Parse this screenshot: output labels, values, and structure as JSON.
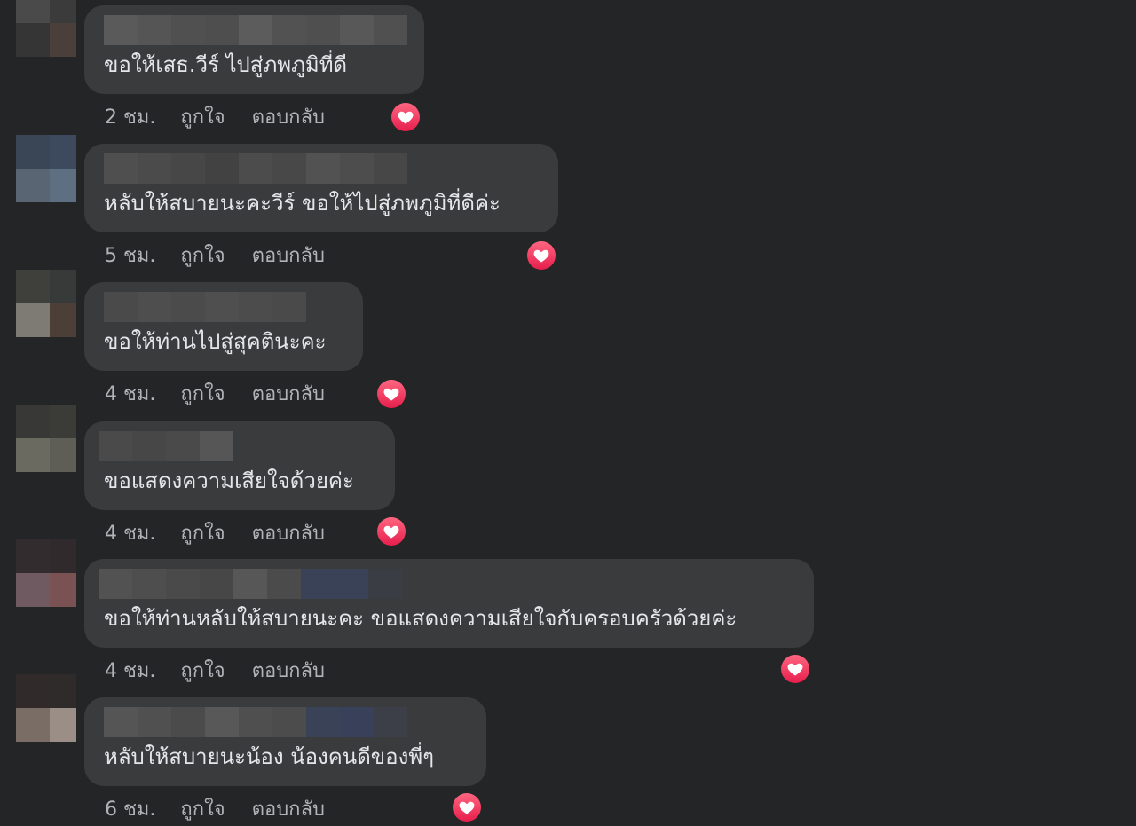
{
  "comments": [
    {
      "text": "ขอให้เสธ.วีร์ ไปสู่ภพภูมิที่ดี",
      "time": "2 ชม.",
      "like": "ถูกใจ",
      "reply": "ตอบกลับ",
      "reaction": "love"
    },
    {
      "text": "หลับให้สบายนะคะวีร์ ขอให้ไปสู่ภพภูมิที่ดีค่ะ",
      "time": "5 ชม.",
      "like": "ถูกใจ",
      "reply": "ตอบกลับ",
      "reaction": "love"
    },
    {
      "text": "ขอให้ท่านไปสู่สุคตินะคะ",
      "time": "4 ชม.",
      "like": "ถูกใจ",
      "reply": "ตอบกลับ",
      "reaction": "love"
    },
    {
      "text": "ขอแสดงความเสียใจด้วยค่ะ",
      "time": "4 ชม.",
      "like": "ถูกใจ",
      "reply": "ตอบกลับ",
      "reaction": "love"
    },
    {
      "text": "ขอให้ท่านหลับให้สบายนะคะ ขอแสดงความเสียใจกับครอบครัวด้วยค่ะ",
      "time": "4 ชม.",
      "like": "ถูกใจ",
      "reply": "ตอบกลับ",
      "reaction": "love"
    },
    {
      "text": "หลับให้สบายนะน้อง น้องคนดีของพี่ๆ",
      "time": "6 ชม.",
      "like": "ถูกใจ",
      "reply": "ตอบกลับ",
      "reaction": "love"
    }
  ],
  "colors": {
    "background": "#242526",
    "bubble": "#3a3b3c",
    "text": "#e4e6eb",
    "meta": "#b0b3b8",
    "reaction_heart": "#f33e58"
  }
}
